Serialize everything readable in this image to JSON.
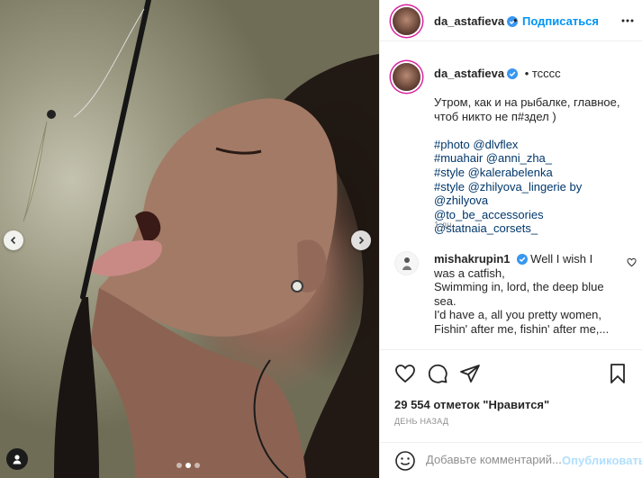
{
  "post": {
    "author": "da_astafieva",
    "verified": true,
    "location": "тсссс",
    "follow_label": "Подписаться",
    "separator": "•",
    "caption_lines": [
      "Утром, как и на рыбалке, главное, чтоб никто не п#здел )",
      ""
    ],
    "caption_tags": [
      "#photo @dlvflex",
      "#muahair @anni_zha_",
      "#style @kalerabelenka",
      "#style @zhilyova_lingerie by @zhilyova",
      "@to_be_accessories @statnaia_corsets_"
    ],
    "caption_age": "1 дн.",
    "carousel": {
      "slide_count": 3,
      "active_slide": 2
    }
  },
  "comment": {
    "author": "mishakrupin1",
    "verified": true,
    "text": "Well I wish I was a catfish,\nSwimming in, lord, the deep blue sea.\nI'd have a, all you pretty women,\nFishin' after me, fishin' after me,..."
  },
  "stats": {
    "likes": "29 554 отметок \"Нравится\"",
    "posted": "ДЕНЬ НАЗАД"
  },
  "composer": {
    "placeholder": "Добавьте комментарий...",
    "publish_label": "Опубликовать"
  },
  "icons": {
    "verified": "verified-badge-icon",
    "more": "more-options-icon",
    "like": "heart-icon",
    "comment": "comment-icon",
    "share": "send-icon",
    "save": "bookmark-icon",
    "emoji": "emoji-icon",
    "prev": "chevron-left-icon",
    "next": "chevron-right-icon",
    "tag": "person-tag-icon"
  },
  "colors": {
    "accent": "#0095f6",
    "link": "#00376b",
    "muted": "#8e8e8e",
    "publish_disabled": "#b2dffc"
  }
}
